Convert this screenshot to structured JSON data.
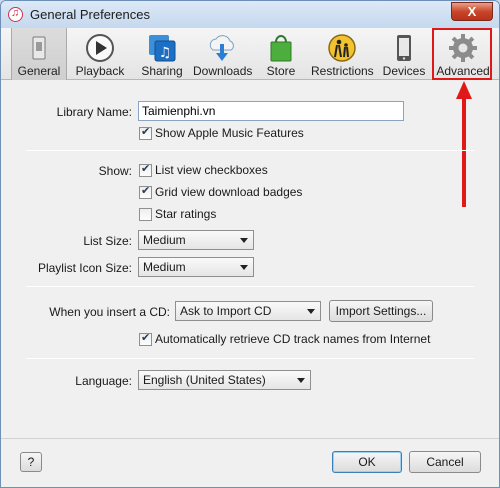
{
  "window": {
    "title": "General Preferences",
    "close_label": "X"
  },
  "toolbar": {
    "items": [
      {
        "label": "General",
        "icon": "general-switch-icon",
        "selected": true
      },
      {
        "label": "Playback",
        "icon": "play-icon"
      },
      {
        "label": "Sharing",
        "icon": "sharing-music-icon"
      },
      {
        "label": "Downloads",
        "icon": "cloud-download-icon"
      },
      {
        "label": "Store",
        "icon": "store-bag-icon"
      },
      {
        "label": "Restrictions",
        "icon": "parental-restrictions-icon"
      },
      {
        "label": "Devices",
        "icon": "device-phone-icon"
      },
      {
        "label": "Advanced",
        "icon": "gear-icon"
      }
    ]
  },
  "general": {
    "library_name_label": "Library Name:",
    "library_name_value": "Taimienphi.vn",
    "show_apple_music": {
      "label": "Show Apple Music Features",
      "checked": true
    },
    "show_label": "Show:",
    "show_options": [
      {
        "label": "List view checkboxes",
        "checked": true
      },
      {
        "label": "Grid view download badges",
        "checked": true
      },
      {
        "label": "Star ratings",
        "checked": false
      }
    ],
    "list_size_label": "List Size:",
    "list_size_value": "Medium",
    "playlist_icon_size_label": "Playlist Icon Size:",
    "playlist_icon_size_value": "Medium",
    "insert_cd_label": "When you insert a CD:",
    "insert_cd_value": "Ask to Import CD",
    "import_settings_label": "Import Settings...",
    "auto_retrieve": {
      "label": "Automatically retrieve CD track names from Internet",
      "checked": true
    },
    "language_label": "Language:",
    "language_value": "English (United States)"
  },
  "footer": {
    "help_label": "?",
    "ok_label": "OK",
    "cancel_label": "Cancel"
  },
  "colors": {
    "highlight": "#e01818",
    "window_border": "#6d8fb8"
  }
}
